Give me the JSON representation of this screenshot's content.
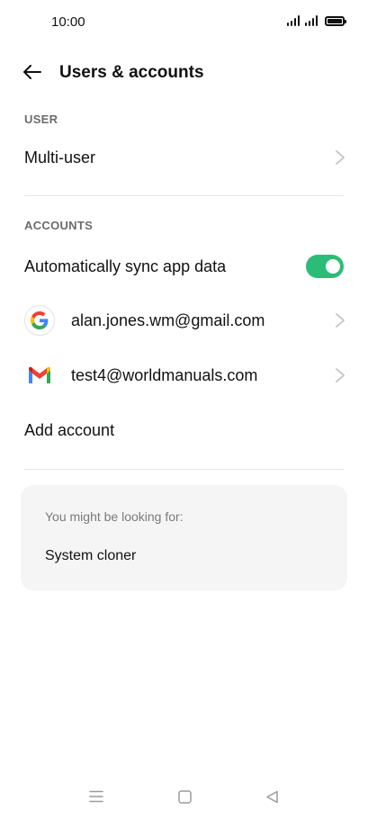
{
  "status_bar": {
    "time": "10:00"
  },
  "header": {
    "title": "Users & accounts"
  },
  "user_section": {
    "label": "USER",
    "items": [
      {
        "label": "Multi-user"
      }
    ]
  },
  "accounts_section": {
    "label": "ACCOUNTS",
    "auto_sync": {
      "label": "Automatically sync app data",
      "enabled": true,
      "color": "#2bbd77"
    },
    "accounts": [
      {
        "label": "alan.jones.wm@gmail.com",
        "icon": "google-icon"
      },
      {
        "label": "test4@worldmanuals.com",
        "icon": "gmail-icon"
      }
    ],
    "add_account": {
      "label": "Add account"
    }
  },
  "suggestions": {
    "heading": "You might be looking for:",
    "items": [
      {
        "label": "System cloner"
      }
    ]
  },
  "nav_bar": {
    "icons": [
      "menu-icon",
      "home-icon",
      "back-triangle-icon"
    ]
  }
}
